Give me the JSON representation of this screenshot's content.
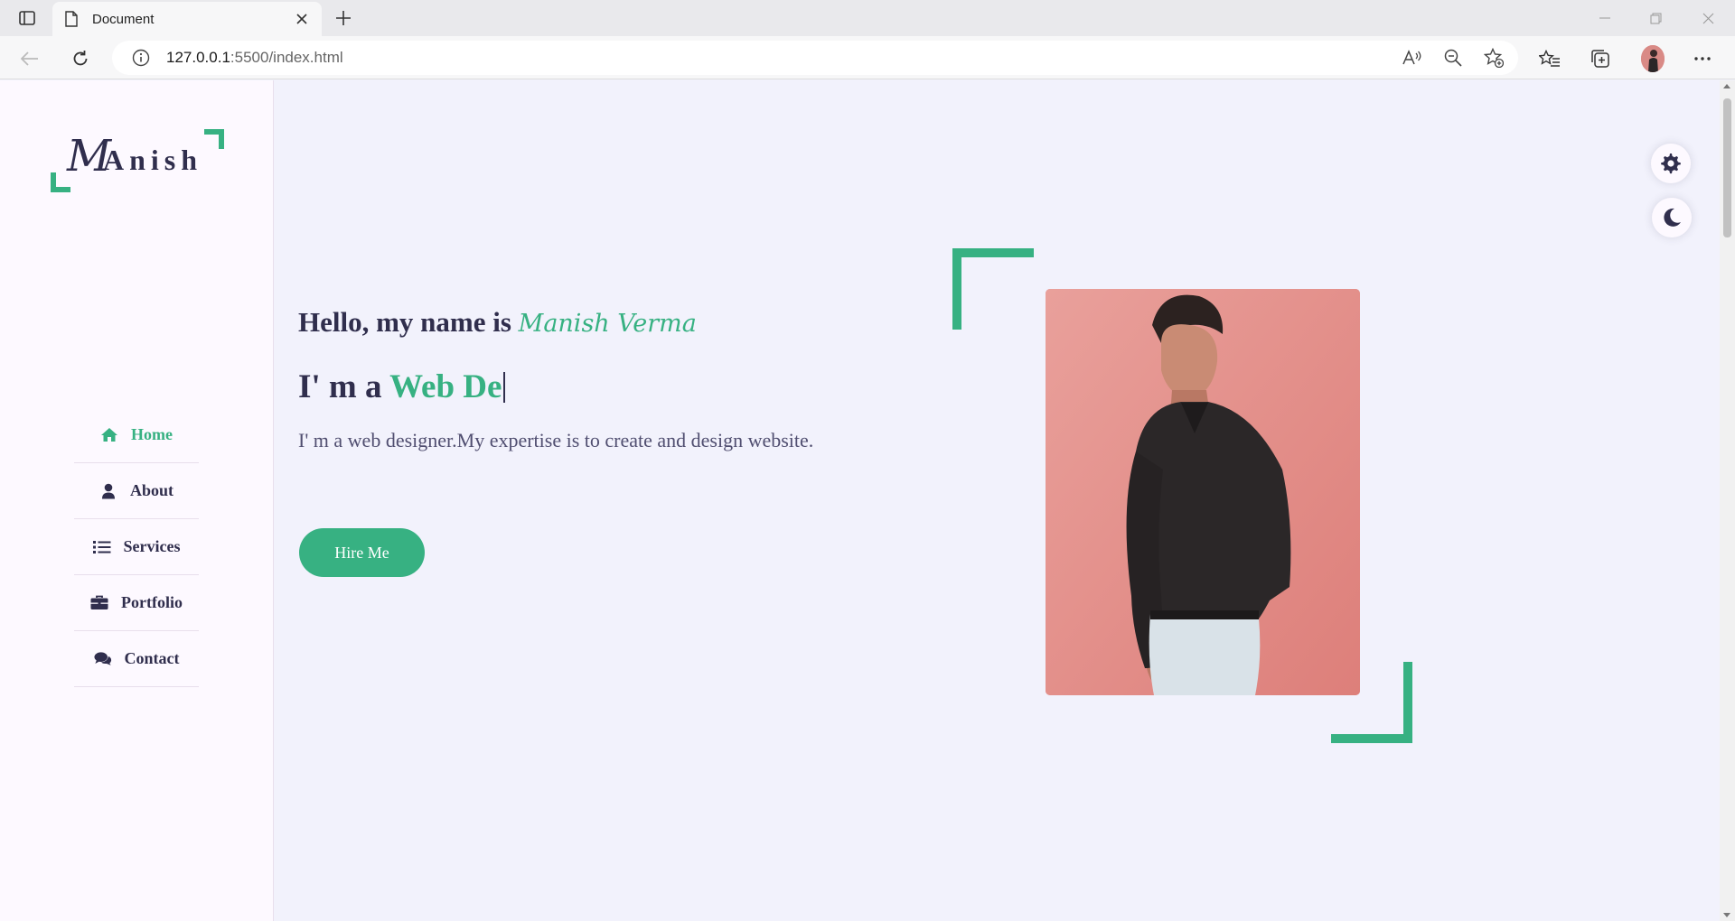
{
  "browser": {
    "tab_title": "Document",
    "url_host": "127.0.0.1",
    "url_path": ":5500/index.html",
    "icons": [
      "sidebar-toggle-icon",
      "document-icon",
      "close-icon",
      "plus-icon",
      "minimize-icon",
      "restore-icon",
      "back-icon",
      "refresh-icon",
      "info-icon",
      "read-aloud-icon",
      "zoom-out-icon",
      "add-favorite-icon",
      "favorites-icon",
      "collections-icon",
      "more-icon"
    ]
  },
  "logo": {
    "first_letter": "M",
    "rest": "Anish"
  },
  "nav": {
    "items": [
      {
        "label": "Home",
        "icon": "home-icon",
        "active": true
      },
      {
        "label": "About",
        "icon": "user-icon",
        "active": false
      },
      {
        "label": "Services",
        "icon": "list-icon",
        "active": false
      },
      {
        "label": "Portfolio",
        "icon": "briefcase-icon",
        "active": false
      },
      {
        "label": "Contact",
        "icon": "comments-icon",
        "active": false
      }
    ]
  },
  "hero": {
    "greeting": "Hello, my name is ",
    "name": "Manish Verma",
    "iam_prefix": "I' m a ",
    "typed_role": "Web De",
    "description": "I' m a web designer.My expertise is to create and design website.",
    "hire_button": "Hire Me"
  },
  "style_switcher": {
    "settings_icon": "gear-icon",
    "theme_icon": "moon-icon"
  },
  "colors": {
    "accent": "#37b182",
    "text": "#302e4d",
    "background": "#f2f2fc",
    "aside": "#fdf9ff"
  }
}
